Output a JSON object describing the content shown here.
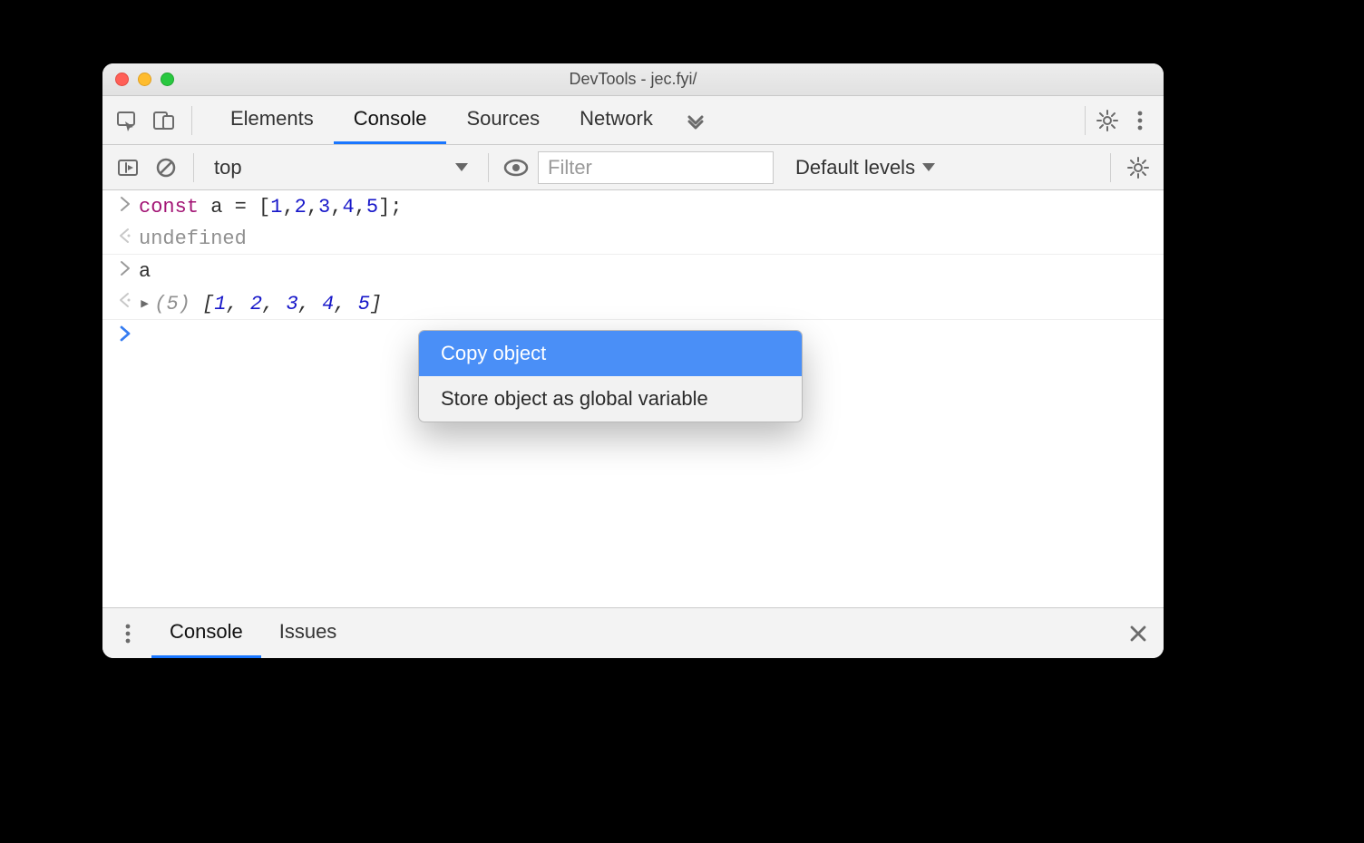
{
  "window": {
    "title": "DevTools - jec.fyi/"
  },
  "toolbar": {
    "tabs": [
      "Elements",
      "Console",
      "Sources",
      "Network"
    ],
    "activeTab": "Console"
  },
  "consoleBar": {
    "context": "top",
    "filterPlaceholder": "Filter",
    "levels": "Default levels"
  },
  "consoleLines": [
    {
      "type": "input",
      "parts": [
        "const",
        " a = [",
        "1",
        ",",
        "2",
        ",",
        "3",
        ",",
        "4",
        ",",
        "5",
        "];"
      ]
    },
    {
      "type": "output",
      "text": "undefined"
    },
    {
      "type": "input",
      "text": "a"
    },
    {
      "type": "array",
      "count": "(5)",
      "open": "[",
      "vals": [
        "1",
        "2",
        "3",
        "4",
        "5"
      ],
      "sep": ", ",
      "close": "]"
    }
  ],
  "contextMenu": {
    "items": [
      "Copy object",
      "Store object as global variable"
    ],
    "highlighted": 0
  },
  "drawer": {
    "tabs": [
      "Console",
      "Issues"
    ],
    "activeTab": "Console"
  }
}
